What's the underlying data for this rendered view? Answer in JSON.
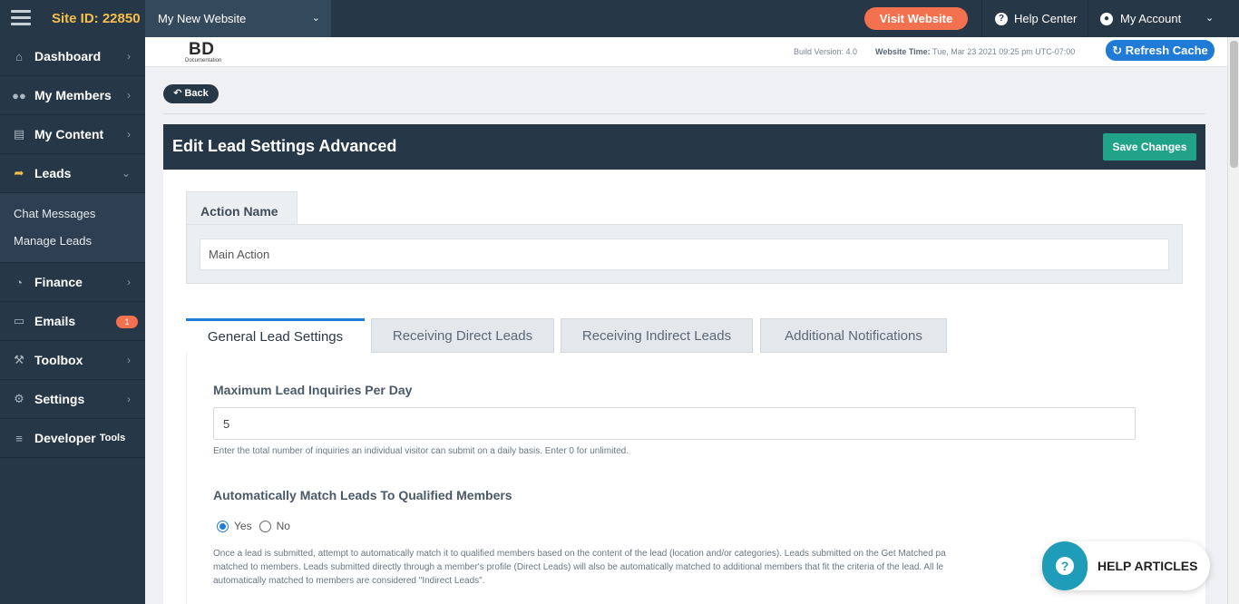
{
  "topbar": {
    "site_id": "Site ID: 22850",
    "website_select": "My New Website",
    "visit_website": "Visit Website",
    "help_center": "Help Center",
    "my_account": "My Account"
  },
  "sidebar": {
    "items": [
      {
        "label": "Dashboard",
        "icon": "home-icon"
      },
      {
        "label": "My Members",
        "icon": "users-icon"
      },
      {
        "label": "My Content",
        "icon": "folder-icon"
      },
      {
        "label": "Leads",
        "icon": "share-icon"
      },
      {
        "label": "Finance",
        "icon": "pie-chart-icon"
      },
      {
        "label": "Emails",
        "icon": "inbox-icon",
        "badge": "1"
      },
      {
        "label": "Toolbox",
        "icon": "wrench-icon"
      },
      {
        "label": "Settings",
        "icon": "gear-icon"
      },
      {
        "label": "Developer",
        "label_small": "Tools",
        "icon": "sliders-icon"
      }
    ],
    "leads_sub": [
      "Chat Messages",
      "Manage Leads"
    ]
  },
  "subheader": {
    "logo_text": "BD",
    "logo_sub": "Documentation",
    "build_version": "Build Version: 4.0",
    "website_time_label": "Website Time:",
    "website_time_value": "Tue, Mar 23 2021 09:25 pm UTC-07:00",
    "refresh_cache": "Refresh Cache"
  },
  "main": {
    "back": "Back",
    "title": "Edit Lead Settings Advanced",
    "save": "Save Changes",
    "action_name_tab": "Action Name",
    "action_name_value": "Main Action",
    "tabs": [
      "General Lead Settings",
      "Receiving Direct Leads",
      "Receiving Indirect Leads",
      "Additional Notifications"
    ],
    "max_label": "Maximum Lead Inquiries Per Day",
    "max_value": "5",
    "max_help": "Enter the total number of inquiries an individual visitor can submit on a daily basis. Enter 0 for unlimited.",
    "auto_label": "Automatically Match Leads To Qualified Members",
    "radio_yes": "Yes",
    "radio_no": "No",
    "auto_help_1": "Once a lead is submitted, attempt to automatically match it to qualified members based on the content of the lead (location and/or categories). Leads submitted on the Get Matched pa",
    "auto_help_2": "matched to members. Leads submitted directly through a member's profile (Direct Leads) will also be automatically matched to additional members that fit the criteria of the lead. All le",
    "auto_help_3": "automatically matched to members are considered \"Indirect Leads\"."
  },
  "help_articles": "HELP ARTICLES",
  "colors": {
    "navy": "#263747",
    "accent_blue": "#1f7bd6",
    "visit_orange": "#f4714f",
    "save_green": "#21a38a",
    "site_id_yellow": "#f5c04a"
  }
}
